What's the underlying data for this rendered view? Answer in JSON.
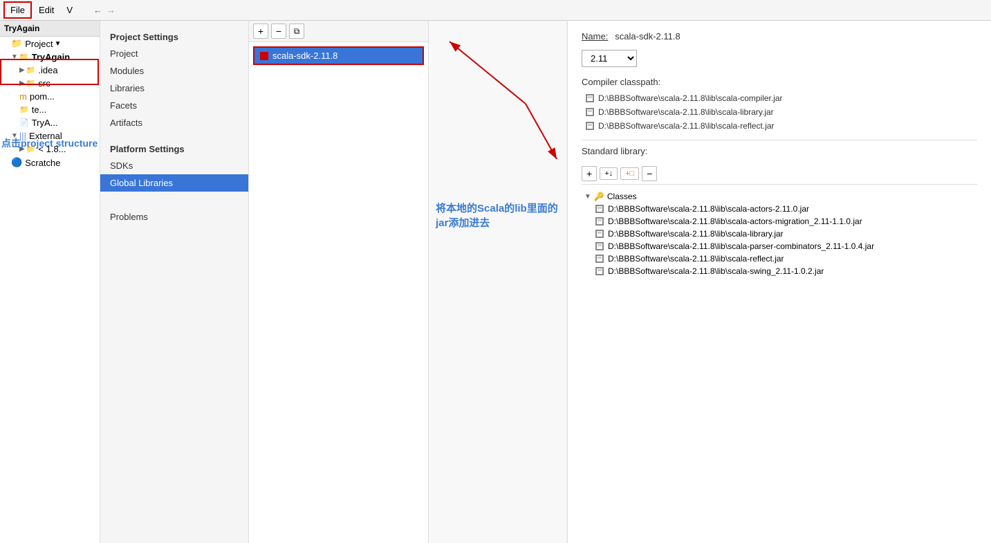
{
  "menubar": {
    "items": [
      "File",
      "Edit",
      "V"
    ]
  },
  "projectTree": {
    "title": "TryAgain",
    "items": [
      {
        "label": "Project",
        "indent": 1,
        "type": "header",
        "hasDropdown": true
      },
      {
        "label": "TryAgain",
        "indent": 1,
        "type": "folder",
        "expanded": true
      },
      {
        "label": ".idea",
        "indent": 2,
        "type": "folder",
        "expanded": false
      },
      {
        "label": "src",
        "indent": 2,
        "type": "folder",
        "expanded": false
      },
      {
        "label": "m",
        "indent": 2,
        "type": "module"
      },
      {
        "label": "te...",
        "indent": 2,
        "type": "folder"
      },
      {
        "label": "m pom...",
        "indent": 2,
        "type": "maven"
      },
      {
        "label": "TryA...",
        "indent": 2,
        "type": "module"
      },
      {
        "label": "External",
        "indent": 1,
        "type": "folder",
        "expanded": true
      },
      {
        "label": "< 1.8...",
        "indent": 2,
        "type": "folder"
      },
      {
        "label": "Scratche",
        "indent": 1,
        "type": "scratch"
      }
    ],
    "clickAnnotation": "点击project structure"
  },
  "settingsPanel": {
    "projectSettingsTitle": "Project Settings",
    "projectSettingsItems": [
      "Project",
      "Modules",
      "Libraries",
      "Facets",
      "Artifacts"
    ],
    "platformSettingsTitle": "Platform Settings",
    "platformSettingsItems": [
      "SDKs",
      "Global Libraries"
    ],
    "otherItems": [
      "Problems"
    ],
    "activeItem": "Global Libraries"
  },
  "sdkPanel": {
    "sdkName": "scala-sdk-2.11.8"
  },
  "detailPanel": {
    "nameLabel": "Name:",
    "nameValue": "scala-sdk-2.11.8",
    "version": "2.11",
    "compilerClasspathLabel": "Compiler classpath:",
    "classpathItems": [
      "D:\\BBBSoftware\\scala-2.11.8\\lib\\scala-compiler.jar",
      "D:\\BBBSoftware\\scala-2.11.8\\lib\\scala-library.jar",
      "D:\\BBBSoftware\\scala-2.11.8\\lib\\scala-reflect.jar"
    ],
    "annotationText": "将本地的Scala的lib里面的jar添加进去",
    "standardLibraryLabel": "Standard library:",
    "classesLabel": "Classes",
    "classesItems": [
      "D:\\BBBSoftware\\scala-2.11.8\\lib\\scala-actors-2.11.0.jar",
      "D:\\BBBSoftware\\scala-2.11.8\\lib\\scala-actors-migration_2.11-1.1.0.jar",
      "D:\\BBBSoftware\\scala-2.11.8\\lib\\scala-library.jar",
      "D:\\BBBSoftware\\scala-2.11.8\\lib\\scala-parser-combinators_2.11-1.0.4.jar",
      "D:\\BBBSoftware\\scala-2.11.8\\lib\\scala-reflect.jar",
      "D:\\BBBSoftware\\scala-2.11.8\\lib\\scala-swing_2.11-1.0.2.jar"
    ]
  }
}
